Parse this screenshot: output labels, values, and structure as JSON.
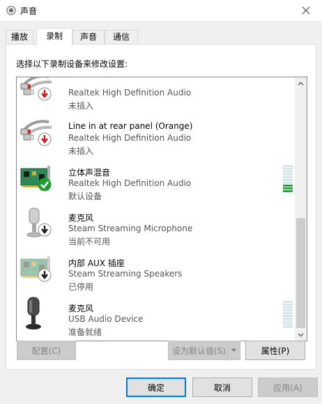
{
  "window": {
    "title": "声音",
    "icon": "speaker-icon",
    "close_icon": "close-icon"
  },
  "tabs": [
    {
      "label": "播放",
      "active": false
    },
    {
      "label": "录制",
      "active": true
    },
    {
      "label": "声音",
      "active": false
    },
    {
      "label": "通信",
      "active": false
    }
  ],
  "instruction": "选择以下录制设备来修改设置:",
  "devices": [
    {
      "name": "",
      "description": "Realtek High Definition Audio",
      "status": "未插入",
      "icon": "rca-jack-icon",
      "badge": "red-down-arrow"
    },
    {
      "name": "Line in at rear panel (Orange)",
      "description": "Realtek High Definition Audio",
      "status": "未插入",
      "icon": "rca-jack-icon",
      "badge": "red-down-arrow"
    },
    {
      "name": "立体声混音",
      "description": "Realtek High Definition Audio",
      "status": "默认设备",
      "icon": "sound-card-icon",
      "badge": "green-check",
      "meter_level": 0.3
    },
    {
      "name": "麦克风",
      "description": "Steam Streaming Microphone",
      "status": "当前不可用",
      "icon": "microphone-icon",
      "badge": "black-down-arrow"
    },
    {
      "name": "内部 AUX 插座",
      "description": "Steam Streaming Speakers",
      "status": "已停用",
      "icon": "sound-card-icon",
      "badge": "black-down-arrow"
    },
    {
      "name": "麦克风",
      "description": "USB Audio Device",
      "status": "准备就绪",
      "icon": "usb-microphone-icon",
      "badge": "",
      "meter_level": 0
    }
  ],
  "buttons": {
    "configure": "配置(C)",
    "set_default": "设为默认值(S)",
    "properties": "属性(P)",
    "ok": "确定",
    "cancel": "取消",
    "apply": "应用(A)"
  },
  "colors": {
    "accent": "#0078d7",
    "meter_on": "#29a239",
    "meter_off": "#d5e6ea"
  }
}
